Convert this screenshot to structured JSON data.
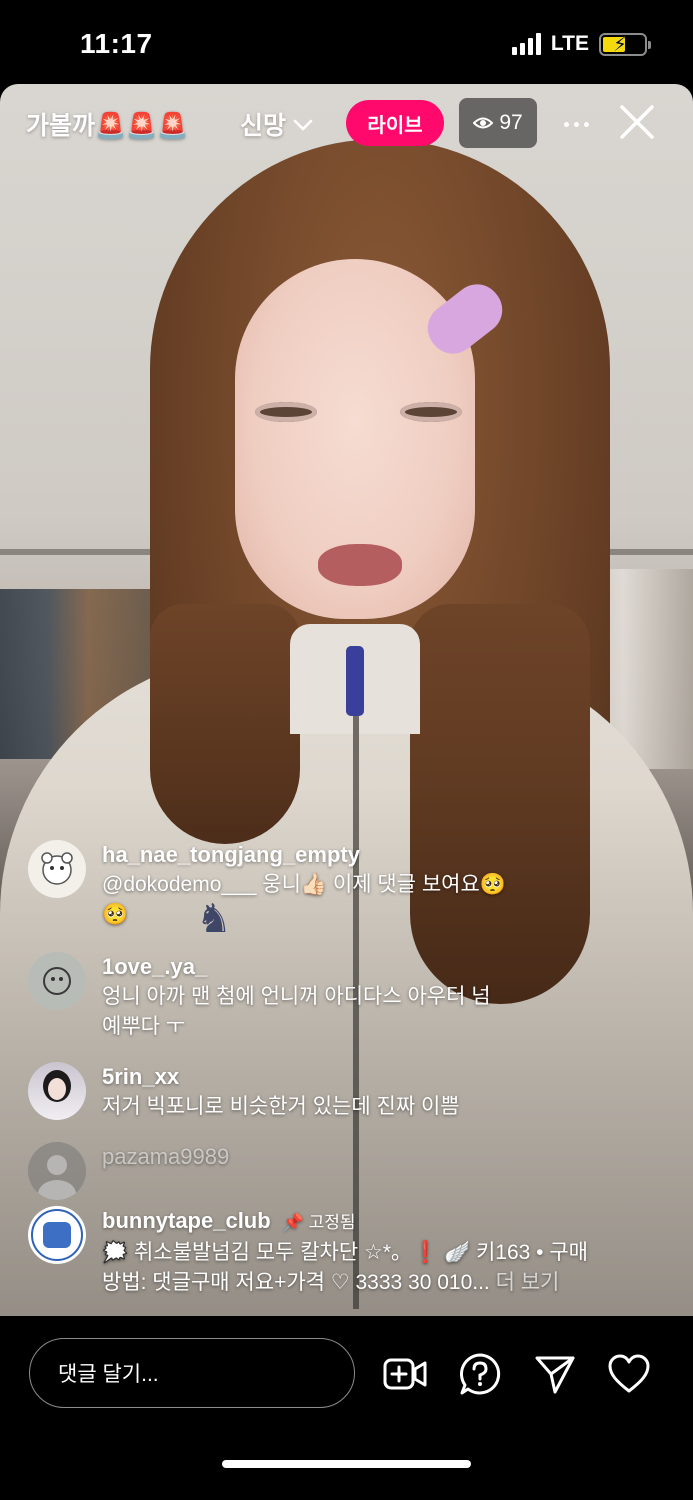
{
  "status_bar": {
    "time": "11:17",
    "network": "LTE",
    "battery_charging": true
  },
  "header": {
    "title": "가볼까🚨🚨🚨",
    "host_name": "신망",
    "live_label": "라이브",
    "viewer_count": "97",
    "icons": {
      "dropdown": "chevron-down-icon",
      "viewers": "eye-icon",
      "more": "more-icon",
      "close": "close-icon"
    }
  },
  "comments": [
    {
      "user": "ha_nae_tongjang_empty",
      "text": "@dokodemo___ 웅니👍🏻 이제 댓글 보여요🥺\n🥺"
    },
    {
      "user": "1ove_.ya_",
      "text": "엉니 아까 맨 첨에 언니꺼 아디다스 아우터 넘\n예뿌다 ㅜ"
    },
    {
      "user": "5rin_xx",
      "text": "저거 빅포니로 비슷한거 있는데 진짜 이쁨"
    },
    {
      "user": "pazama9989",
      "text": ""
    },
    {
      "user": "bunnytape_club",
      "pinned_label": "📌 고정됨",
      "text": "🗯️ 취소불발넘김 모두 칼차단 ☆*。❗ 🪽 키163 • 구매\n방법: 댓글구매 저요+가격 ♡ 3333 30 010...",
      "more_label": " 더 보기"
    }
  ],
  "bottom_bar": {
    "comment_placeholder": "댓글 달기...",
    "icons": [
      "add-video-icon",
      "question-icon",
      "send-icon",
      "heart-icon"
    ]
  },
  "colors": {
    "live_badge": "#ff0a6c",
    "battery": "#f5d90a"
  }
}
